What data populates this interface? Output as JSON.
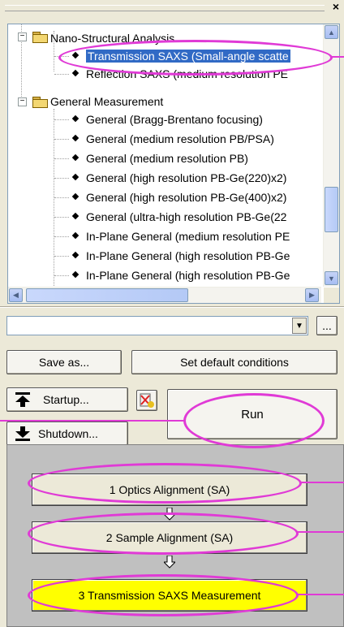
{
  "tree": {
    "groups": [
      {
        "label": "Nano-Structural Analysis",
        "items": [
          "Transmission SAXS (Small-angle scatte",
          "Reflection SAXS (medium resolution PE"
        ]
      },
      {
        "label": "General Measurement",
        "items": [
          "General (Bragg-Brentano focusing)",
          "General (medium resolution PB/PSA)",
          "General (medium resolution PB)",
          "General (high resolution PB-Ge(220)x2)",
          "General (high resolution PB-Ge(400)x2)",
          "General (ultra-high resolution PB-Ge(22",
          "In-Plane General (medium resolution PE",
          "In-Plane General (high resolution PB-Ge",
          "In-Plane General (high resolution PB-Ge"
        ]
      }
    ],
    "selected_item": "Transmission SAXS (Small-angle scatte"
  },
  "condition_select": {
    "value": "",
    "ellipsis_label": "..."
  },
  "buttons": {
    "save_as": "Save as...",
    "set_default": "Set default conditions",
    "startup": "Startup...",
    "shutdown": "Shutdown...",
    "run": "Run"
  },
  "steps": [
    {
      "label": "1 Optics Alignment (SA)"
    },
    {
      "label": "2 Sample Alignment (SA)"
    },
    {
      "label": "3 Transmission SAXS Measurement"
    }
  ],
  "colors": {
    "highlight": "#e03ad6",
    "selection": "#316ac5",
    "active_step": "#ffff00"
  },
  "icons": {
    "close": "close-icon",
    "folder": "folder-icon",
    "startup": "startup-icon",
    "shutdown": "shutdown-icon",
    "settings": "settings-check-icon"
  }
}
